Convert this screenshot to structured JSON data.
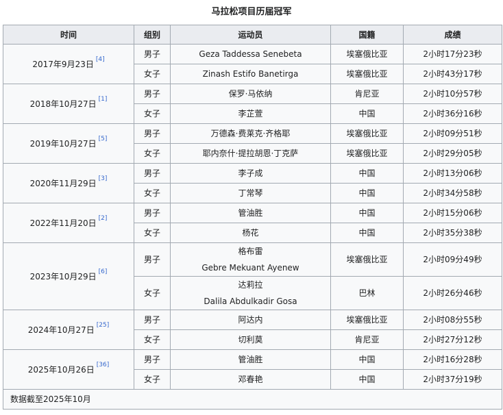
{
  "caption": "马拉松项目历届冠军",
  "headers": [
    "时间",
    "组别",
    "运动员",
    "国籍",
    "成绩"
  ],
  "groups": [
    {
      "date": "2017年9月23日",
      "ref": "[4]",
      "rows": [
        {
          "group": "男子",
          "athlete": [
            "Geza Taddessa Senebeta"
          ],
          "nation": "埃塞俄比亚",
          "time": "2小时17分23秒"
        },
        {
          "group": "女子",
          "athlete": [
            "Zinash Estifo Banetirga"
          ],
          "nation": "埃塞俄比亚",
          "time": "2小时43分17秒"
        }
      ]
    },
    {
      "date": "2018年10月27日",
      "ref": "[1]",
      "rows": [
        {
          "group": "男子",
          "athlete": [
            "保罗·马依纳"
          ],
          "nation": "肯尼亚",
          "time": "2小时10分57秒"
        },
        {
          "group": "女子",
          "athlete": [
            "李芷萱"
          ],
          "nation": "中国",
          "time": "2小时36分16秒"
        }
      ]
    },
    {
      "date": "2019年10月27日",
      "ref": "[5]",
      "rows": [
        {
          "group": "男子",
          "athlete": [
            "万德森·费莱克·齐格耶"
          ],
          "nation": "埃塞俄比亚",
          "time": "2小时09分51秒"
        },
        {
          "group": "女子",
          "athlete": [
            "耶内奈什·提拉胡恩·丁克萨"
          ],
          "nation": "埃塞俄比亚",
          "time": "2小时29分05秒"
        }
      ]
    },
    {
      "date": "2020年11月29日",
      "ref": "[3]",
      "rows": [
        {
          "group": "男子",
          "athlete": [
            "李子成"
          ],
          "nation": "中国",
          "time": "2小时13分06秒"
        },
        {
          "group": "女子",
          "athlete": [
            "丁常琴"
          ],
          "nation": "中国",
          "time": "2小时34分58秒"
        }
      ]
    },
    {
      "date": "2022年11月20日",
      "ref": "[2]",
      "rows": [
        {
          "group": "男子",
          "athlete": [
            "管油胜"
          ],
          "nation": "中国",
          "time": "2小时15分06秒"
        },
        {
          "group": "女子",
          "athlete": [
            "杨花"
          ],
          "nation": "中国",
          "time": "2小时35分38秒"
        }
      ]
    },
    {
      "date": "2023年10月29日",
      "ref": "[6]",
      "rows": [
        {
          "group": "男子",
          "athlete": [
            "格布雷",
            "Gebre Mekuant Ayenew"
          ],
          "nation": "埃塞俄比亚",
          "time": "2小时09分49秒"
        },
        {
          "group": "女子",
          "athlete": [
            "达莉拉",
            "Dalila Abdulkadir Gosa"
          ],
          "nation": "巴林",
          "time": "2小时26分46秒"
        }
      ]
    },
    {
      "date": "2024年10月27日",
      "ref": "[25]",
      "rows": [
        {
          "group": "男子",
          "athlete": [
            "阿达内"
          ],
          "nation": "埃塞俄比亚",
          "time": "2小时08分55秒"
        },
        {
          "group": "女子",
          "athlete": [
            "切利莫"
          ],
          "nation": "肯尼亚",
          "time": "2小时27分12秒"
        }
      ]
    },
    {
      "date": "2025年10月26日",
      "ref": "[36]",
      "rows": [
        {
          "group": "男子",
          "athlete": [
            "管油胜"
          ],
          "nation": "中国",
          "time": "2小时16分28秒"
        },
        {
          "group": "女子",
          "athlete": [
            "邓春艳"
          ],
          "nation": "中国",
          "time": "2小时37分19秒"
        }
      ]
    }
  ],
  "footer": "数据截至2025年10月",
  "colors": {
    "header_bg": "#eaecf0",
    "cell_bg": "#f8f9fa",
    "border": "#a2a9b1",
    "link": "#3366cc"
  }
}
